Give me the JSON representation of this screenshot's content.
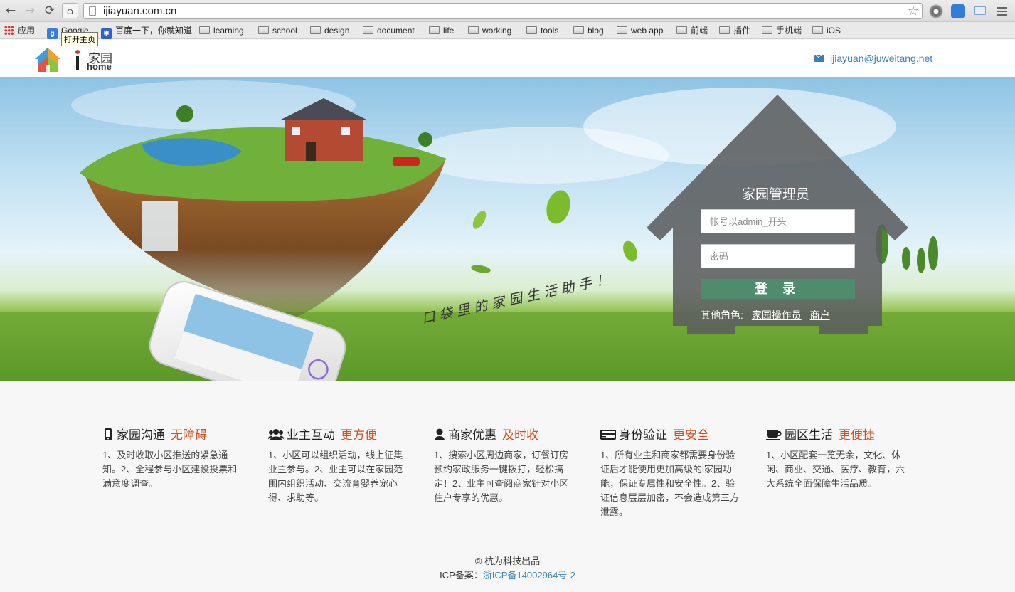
{
  "browser": {
    "url": "ijiayuan.com.cn",
    "tooltip": "打开主页",
    "back_icon": "←",
    "forward_icon": "→",
    "reload_icon": "⟳",
    "home_icon": "⌂",
    "star_icon": "☆",
    "bookmarks": {
      "apps": "应用",
      "google": "Google",
      "baidu": "百度一下，你就知道",
      "folders": [
        "learning",
        "school",
        "design",
        "document",
        "life",
        "working",
        "tools",
        "blog",
        "web app",
        "前端",
        "插件",
        "手机端",
        "iOS"
      ]
    }
  },
  "header": {
    "logo_text_cn": "家园",
    "logo_text_en": "home",
    "email": "ijiayuan@juweitang.net"
  },
  "hero": {
    "slogan": "口袋里的家园生活助手！"
  },
  "login": {
    "title": "家园管理员",
    "username_placeholder": "帐号以admin_开头",
    "password_placeholder": "密码",
    "submit_label": "登 录",
    "other_roles_label": "其他角色:",
    "role_operator": "家园操作员",
    "role_merchant": "商户"
  },
  "features": [
    {
      "icon": "mobile-icon",
      "title": "家园沟通",
      "subtitle": "无障碍",
      "desc": "1、及时收取小区推送的紧急通知。2、全程参与小区建设投票和满意度调查。"
    },
    {
      "icon": "users-icon",
      "title": "业主互动",
      "subtitle": "更方便",
      "desc": "1、小区可以组织活动，线上征集业主参与。2、业主可以在家园范围内组织活动、交流育婴养宠心得、求助等。"
    },
    {
      "icon": "user-icon",
      "title": "商家优惠",
      "subtitle": "及时收",
      "desc": "1、搜索小区周边商家，订餐订房预约家政服务一键拨打，轻松搞定！2、业主可查阅商家针对小区住户专享的优惠。"
    },
    {
      "icon": "credit-card-icon",
      "title": "身份验证",
      "subtitle": "更安全",
      "desc": "1、所有业主和商家都需要身份验证后才能使用更加高级的i家园功能，保证专属性和安全性。2、验证信息层层加密，不会造成第三方泄露。"
    },
    {
      "icon": "coffee-icon",
      "title": "园区生活",
      "subtitle": "更便捷",
      "desc": "1、小区配套一览无余，文化、休闲、商业、交通、医疗、教育，六大系统全面保障生活品质。"
    }
  ],
  "footer": {
    "copyright": "© 杭为科技出品",
    "icp_label": "ICP备案：",
    "icp_number": "浙ICP备14002964号-2"
  },
  "colors": {
    "accent": "#d0501f",
    "link": "#3b83bd",
    "login_button": "#4f8c6d"
  }
}
